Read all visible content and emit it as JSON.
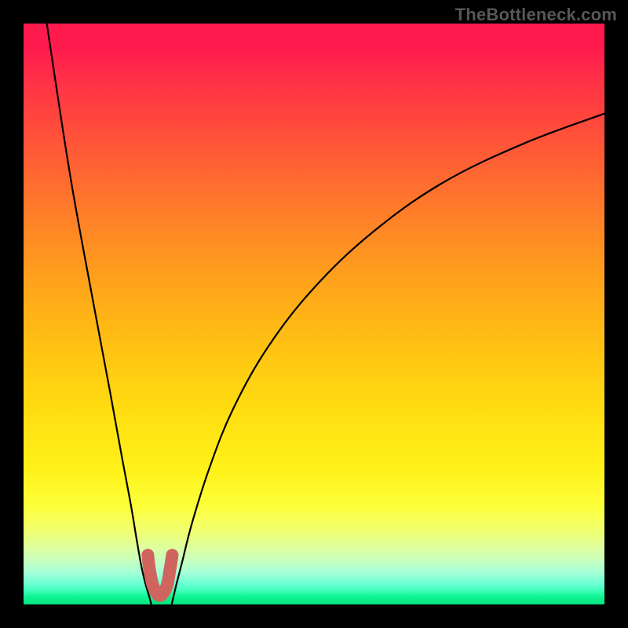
{
  "watermark": "TheBottleneck.com",
  "chart_data": {
    "type": "line",
    "title": "",
    "xlabel": "",
    "ylabel": "",
    "xlim": [
      0,
      100
    ],
    "ylim": [
      0,
      100
    ],
    "gradient_stops": [
      {
        "pct": 0,
        "color": "#ff1a4e"
      },
      {
        "pct": 28,
        "color": "#ff6e2f"
      },
      {
        "pct": 58,
        "color": "#ffc812"
      },
      {
        "pct": 83,
        "color": "#fdff3a"
      },
      {
        "pct": 93,
        "color": "#c7ffc0"
      },
      {
        "pct": 100,
        "color": "#03e27d"
      }
    ],
    "series": [
      {
        "name": "left_curve",
        "x": [
          4.0,
          8.0,
          12.0,
          15.0,
          17.0,
          18.5,
          19.5,
          20.3,
          21.0,
          21.6,
          22.0
        ],
        "y": [
          100.0,
          74.0,
          52.0,
          36.0,
          25.0,
          17.0,
          11.0,
          6.5,
          3.5,
          1.5,
          0.0
        ]
      },
      {
        "name": "right_curve",
        "x": [
          25.5,
          26.2,
          27.3,
          29.0,
          32.0,
          36.0,
          42.0,
          50.0,
          60.0,
          72.0,
          86.0,
          100.0
        ],
        "y": [
          0.0,
          3.0,
          7.3,
          14.0,
          23.5,
          33.5,
          44.2,
          54.5,
          64.0,
          72.5,
          79.3,
          84.5
        ]
      }
    ],
    "marker_cluster": {
      "description": "thick_rounded_marker_at_valley_floor",
      "color": "#d0645e",
      "points": [
        {
          "x": 21.4,
          "y": 8.5
        },
        {
          "x": 21.7,
          "y": 6.0
        },
        {
          "x": 22.3,
          "y": 3.2
        },
        {
          "x": 23.4,
          "y": 1.5
        },
        {
          "x": 24.6,
          "y": 3.0
        },
        {
          "x": 25.2,
          "y": 6.0
        },
        {
          "x": 25.6,
          "y": 8.5
        }
      ]
    }
  }
}
